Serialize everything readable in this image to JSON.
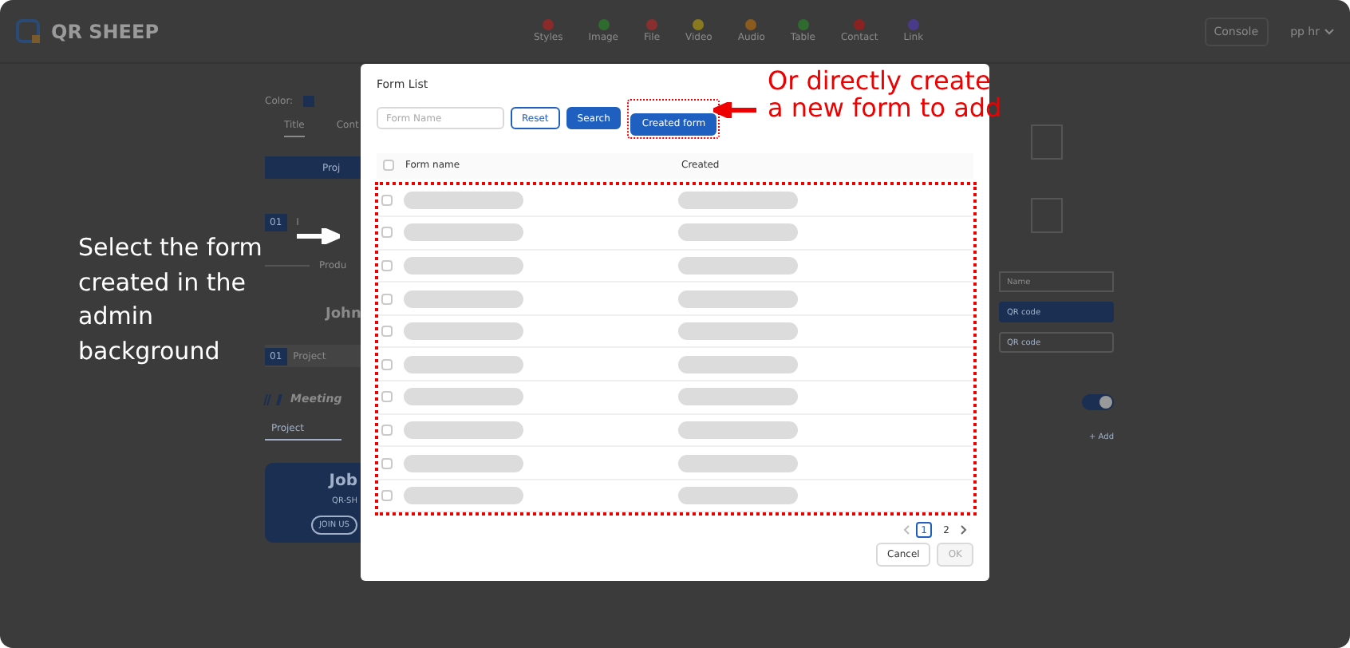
{
  "header": {
    "logo": "QR SHEEP",
    "tools": [
      {
        "label": "Styles",
        "color": "#8a2a2a"
      },
      {
        "label": "Image",
        "color": "#2f6a2f"
      },
      {
        "label": "File",
        "color": "#8a2f2f"
      },
      {
        "label": "Video",
        "color": "#8a7a1f"
      },
      {
        "label": "Audio",
        "color": "#8a5a1f"
      },
      {
        "label": "Table",
        "color": "#2f6a2f"
      },
      {
        "label": "Contact",
        "color": "#8a2222"
      },
      {
        "label": "Link",
        "color": "#4a3a8a"
      }
    ],
    "console": "Console",
    "language": "pp hr"
  },
  "left_panel": {
    "color_label": "Color:",
    "tabs": [
      {
        "label": "Title",
        "selected": true
      },
      {
        "label": "Cont",
        "selected": false
      }
    ],
    "banner": "Proj",
    "numbered_item": {
      "number": "01",
      "text": "I"
    },
    "divider_text": "Produ",
    "join_text": "John",
    "project_bar": {
      "number": "01",
      "text": "Project"
    },
    "meeting": "Meeting",
    "project_tab": "Project",
    "card": {
      "title": "Job",
      "subtitle": "QR-SH",
      "button": "JOIN US"
    }
  },
  "right_panel": {
    "name_placeholder": "Name",
    "primary_button": "QR code",
    "secondary_button": "QR code",
    "toggle_on": true,
    "add_link": "+ Add"
  },
  "dialog": {
    "title": "Form List",
    "search_placeholder": "Form Name",
    "reset": "Reset",
    "search": "Search",
    "create": "Created form",
    "select_all_checked": false,
    "columns": [
      "Form name",
      "Created"
    ],
    "rows": [
      {
        "checked": false
      },
      {
        "checked": false
      },
      {
        "checked": false
      },
      {
        "checked": false
      },
      {
        "checked": false
      },
      {
        "checked": false
      },
      {
        "checked": false
      },
      {
        "checked": false
      },
      {
        "checked": false
      },
      {
        "checked": false
      }
    ],
    "pages": [
      {
        "label": "1",
        "selected": true
      },
      {
        "label": "2",
        "selected": false
      }
    ],
    "cancel": "Cancel",
    "ok": "OK",
    "ok_disabled": true
  },
  "annotations": {
    "left": "Select the form created in the admin background",
    "right": [
      "Or directly create",
      "a new form to add"
    ]
  }
}
